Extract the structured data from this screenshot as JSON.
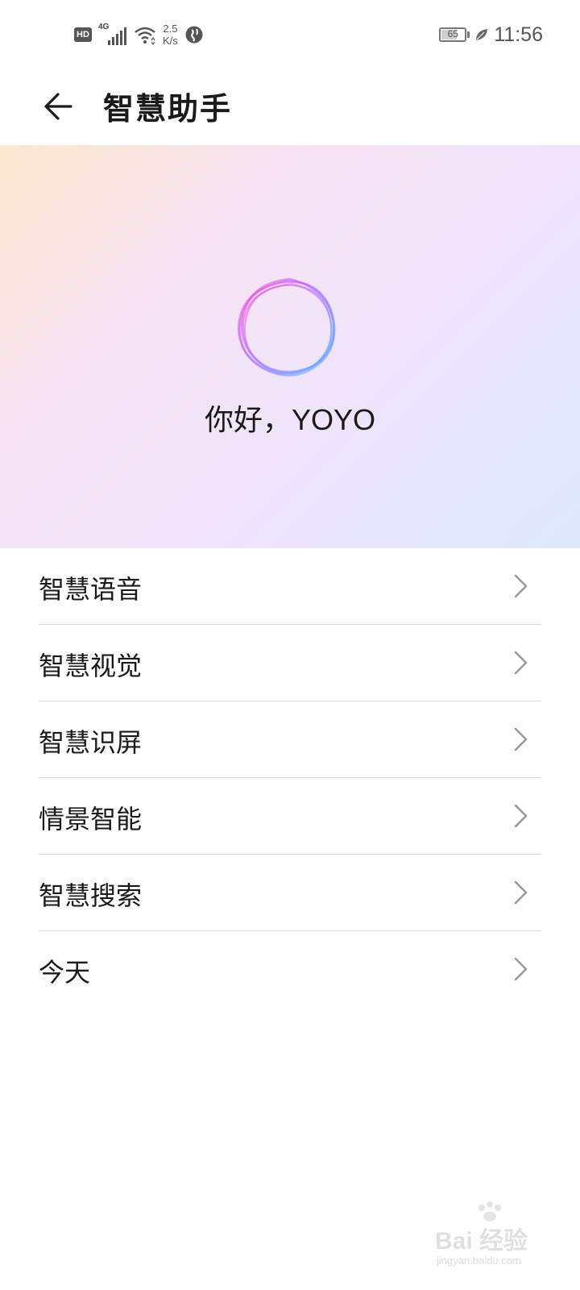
{
  "status_bar": {
    "hd_label": "HD",
    "network_label": "4G",
    "speed_value": "2.5",
    "speed_unit": "K/s",
    "battery_level": "65",
    "time": "11:56"
  },
  "header": {
    "title": "智慧助手",
    "back_icon": "arrow-left-icon"
  },
  "hero": {
    "greeting": "你好，YOYO",
    "orb_icon": "voice-orb-icon",
    "colors": {
      "pink": "#ff4fd8",
      "blue": "#5ab8ff"
    }
  },
  "menu": {
    "items": [
      {
        "label": "智慧语音"
      },
      {
        "label": "智慧视觉"
      },
      {
        "label": "智慧识屏"
      },
      {
        "label": "情景智能"
      },
      {
        "label": "智慧搜索"
      },
      {
        "label": "今天"
      }
    ],
    "chevron_icon": "chevron-right-icon"
  },
  "watermark": {
    "main": "Bai 经验",
    "sub": "jingyan.baidu.com"
  }
}
